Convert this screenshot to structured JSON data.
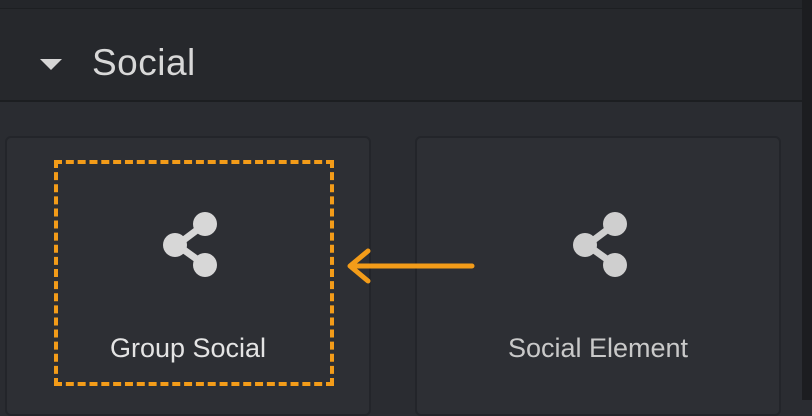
{
  "section": {
    "title": "Social",
    "caret_icon": "caret-down-icon"
  },
  "widgets": [
    {
      "label": "Group Social",
      "icon": "share-icon",
      "highlighted": true
    },
    {
      "label": "Social Element",
      "icon": "share-icon",
      "highlighted": false
    }
  ],
  "annotation": {
    "color": "#f39c19",
    "arrow_direction": "left"
  }
}
